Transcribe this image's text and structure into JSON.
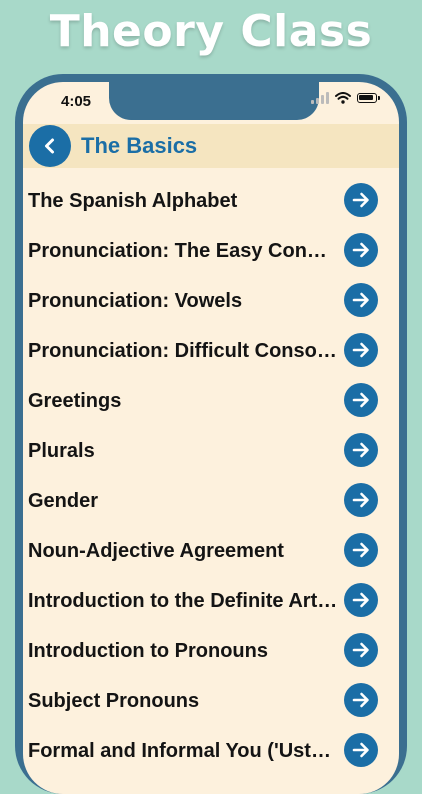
{
  "banner": {
    "title": "Theory Class"
  },
  "status_bar": {
    "time": "4:05"
  },
  "header": {
    "title": "The Basics",
    "back_icon": "chevron-left-icon"
  },
  "lessons": [
    {
      "label": "The Spanish Alphabet"
    },
    {
      "label": "Pronunciation: The Easy Consonants"
    },
    {
      "label": "Pronunciation: Vowels"
    },
    {
      "label": "Pronunciation: Difficult Consonants"
    },
    {
      "label": "Greetings"
    },
    {
      "label": "Plurals"
    },
    {
      "label": "Gender"
    },
    {
      "label": "Noun-Adjective Agreement"
    },
    {
      "label": "Introduction to the Definite Articles"
    },
    {
      "label": "Introduction to Pronouns"
    },
    {
      "label": "Subject Pronouns"
    },
    {
      "label": "Formal and Informal You ('Usted' and 'Tú')"
    }
  ],
  "colors": {
    "background": "#a8d9c9",
    "phone_frame": "#3b6f90",
    "screen": "#fdf1dd",
    "header_bar": "#f5e5c0",
    "accent": "#1b6ea6"
  }
}
